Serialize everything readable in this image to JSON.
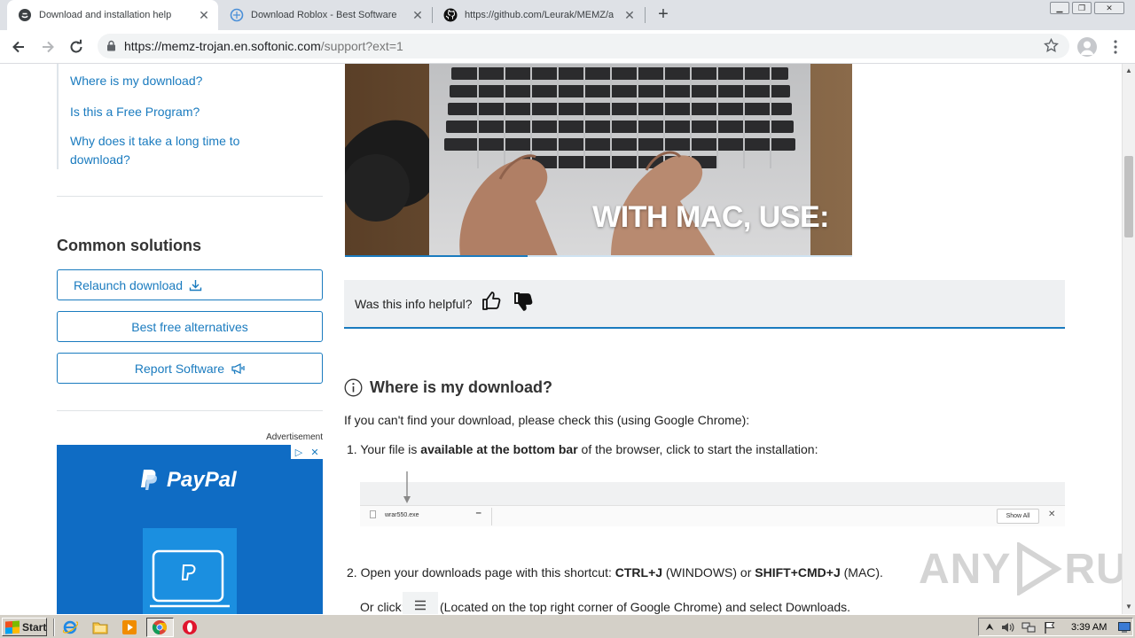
{
  "browser": {
    "tabs": [
      {
        "title": "Download and installation help",
        "active": true,
        "icon": "softonic-icon"
      },
      {
        "title": "Download Roblox - Best Software & Apps",
        "active": false,
        "icon": "softonic-icon"
      },
      {
        "title": "https://github.com/Leurak/MEMZ/archive/master.zip",
        "active": false,
        "icon": "github-icon"
      }
    ],
    "url_main": "https://memz-trojan.en.softonic.com",
    "url_path": "/support?ext=1"
  },
  "sidebar": {
    "links": [
      "Where is my download?",
      "Is this a Free Program?",
      "Why does it take a long time to download?"
    ],
    "common_title": "Common solutions",
    "buttons": {
      "relaunch": "Relaunch download",
      "alternatives": "Best free alternatives",
      "report": "Report Software"
    },
    "ad_label": "Advertisement",
    "ad_brand": "PayPal"
  },
  "video": {
    "caption": "WITH MAC, USE:",
    "progress": 0.36
  },
  "helpful": {
    "question": "Was this info helpful?"
  },
  "section": {
    "title": "Where is my download?",
    "intro": "If you can't find your download, please check this (using Google Chrome):",
    "step1_num": "1.",
    "step1_pre": "Your file is ",
    "step1_bold": "available at the bottom bar",
    "step1_post": " of the browser, click to start the installation:",
    "shelf_file": "wrar550.exe",
    "shelf_show_all": "Show All",
    "step2_num": "2.",
    "step2_pre": "Open your downloads page with this shortcut: ",
    "step2_key1": "CTRL+J",
    "step2_mid": " (WINDOWS) or ",
    "step2_key2": "SHIFT+CMD+J",
    "step2_post": " (MAC).",
    "step2b_pre": "Or click:",
    "step2b_post": "(Located on the top right corner of Google Chrome) and select Downloads."
  },
  "watermark": {
    "left": "ANY",
    "right": "RUN"
  },
  "taskbar": {
    "start": "Start",
    "clock": "3:39 AM"
  },
  "colors": {
    "accent": "#1a7bbf",
    "paypal_bg": "#0f6cc4"
  }
}
